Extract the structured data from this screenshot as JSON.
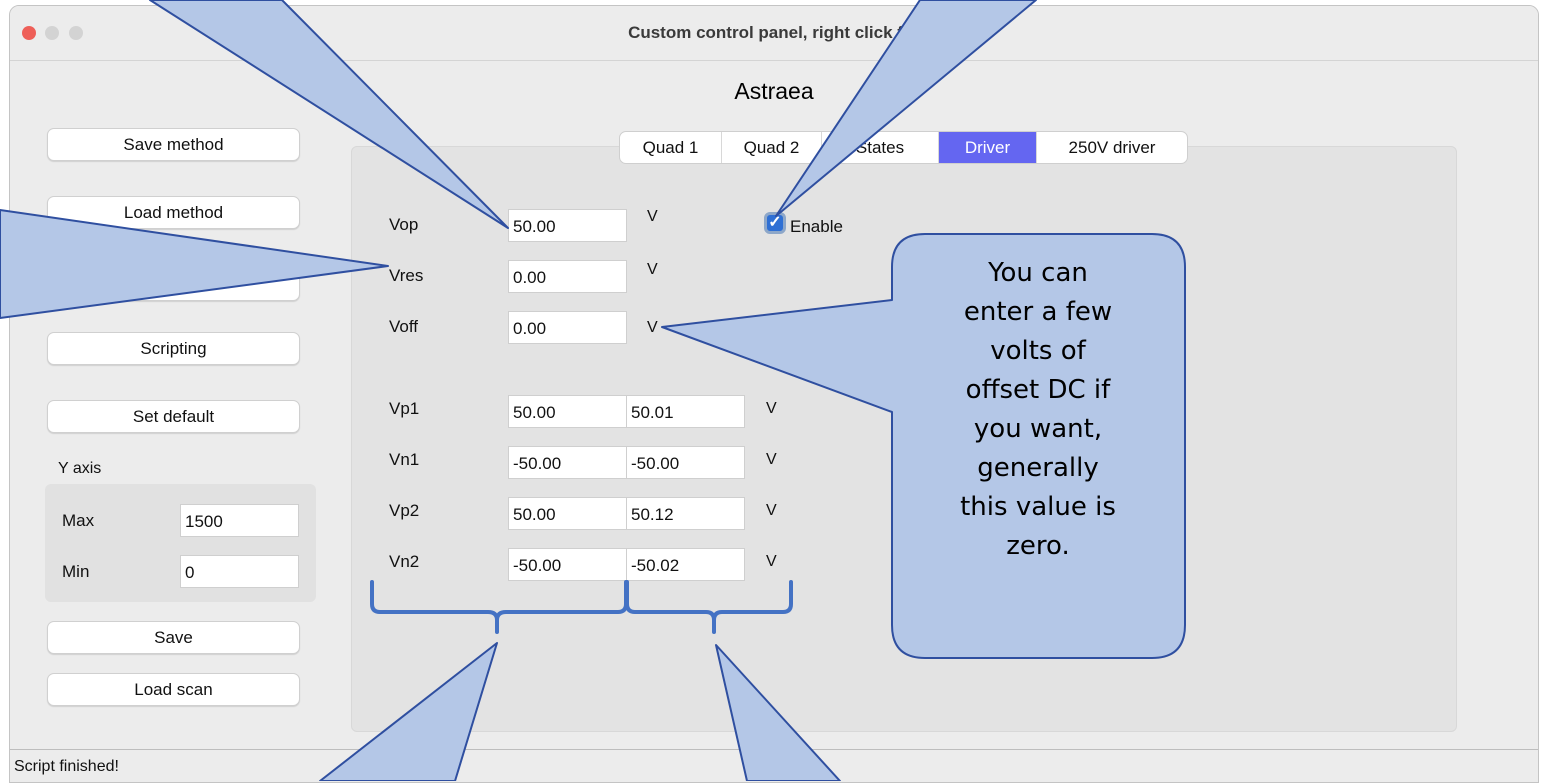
{
  "window": {
    "title": "Custom control panel, right click for",
    "traffic_colors": [
      "#ee5f58",
      "#d3d3d3",
      "#d3d3d3"
    ]
  },
  "app_name": "Astraea",
  "sidebar": {
    "buttons": [
      {
        "label": "Save method"
      },
      {
        "label": "Load method"
      },
      {
        "label": ""
      },
      {
        "label": "Scripting"
      },
      {
        "label": "Set default"
      }
    ],
    "y_axis": {
      "label": "Y axis",
      "max_label": "Max",
      "max_value": "1500",
      "min_label": "Min",
      "min_value": "0"
    },
    "save_label": "Save",
    "load_scan_label": "Load scan"
  },
  "tabs": [
    {
      "label": "Quad 1",
      "active": false
    },
    {
      "label": "Quad 2",
      "active": false
    },
    {
      "label": "States",
      "active": false
    },
    {
      "label": "Driver",
      "active": true
    },
    {
      "label": "250V driver",
      "active": false
    }
  ],
  "driver": {
    "enable_label": "Enable",
    "enable_checked": true,
    "unit": "V",
    "single_fields": [
      {
        "label": "Vop",
        "value": "50.00"
      },
      {
        "label": "Vres",
        "value": "0.00"
      },
      {
        "label": "Voff",
        "value": "0.00"
      }
    ],
    "pair_fields": [
      {
        "label": "Vp1",
        "value1": "50.00",
        "value2": "50.01"
      },
      {
        "label": "Vn1",
        "value1": "-50.00",
        "value2": "-50.00"
      },
      {
        "label": "Vp2",
        "value1": "50.00",
        "value2": "50.12"
      },
      {
        "label": "Vn2",
        "value1": "-50.00",
        "value2": "-50.02"
      }
    ]
  },
  "status": "Script finished!",
  "callout": {
    "text": "You can\nenter a few\nvolts of\noffset DC if\nyou want,\ngenerally\nthis value is\nzero.",
    "fill": "#b4c7e7",
    "stroke": "#2f4fa0"
  }
}
